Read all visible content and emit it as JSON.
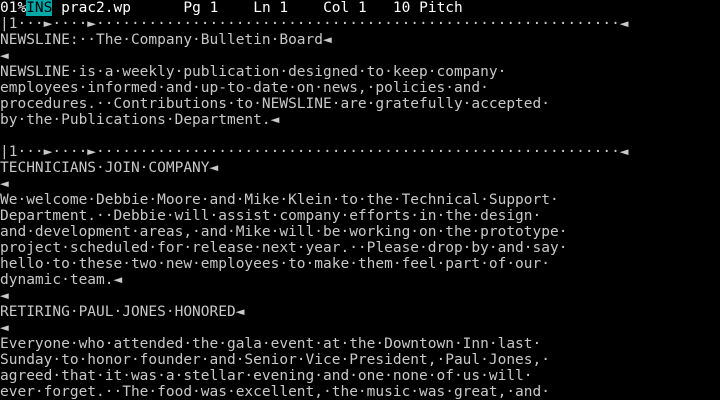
{
  "status_bar": {
    "percent": "01%",
    "mode": "INS",
    "filename": "prac2.wp",
    "page": "Pg 1",
    "line": "Ln 1",
    "column": "Col 1",
    "pitch": "10 Pitch"
  },
  "ruler": "|1···►····►····························································◄",
  "ruler2": "|1···►····►····························································◄",
  "document_lines": [
    "NEWSLINE:··The·Company·Bulletin·Board◄",
    "◄",
    "NEWSLINE·is·a·weekly·publication·designed·to·keep·company·",
    "employees·informed·and·up-to-date·on·news,·policies·and·",
    "procedures.··Contributions·to·NEWSLINE·are·gratefully·accepted·",
    "by·the·Publications·Department.◄",
    "",
    "TECHNICIANS·JOIN·COMPANY◄",
    "◄",
    "We·welcome·Debbie·Moore·and·Mike·Klein·to·the·Technical·Support·",
    "Department.··Debbie·will·assist·company·efforts·in·the·design·",
    "and·development·areas,·and·Mike·will·be·working·on·the·prototype·",
    "project·scheduled·for·release·next·year.··Please·drop·by·and·say·",
    "hello·to·these·two·new·employees·to·make·them·feel·part·of·our·",
    "dynamic·team.◄",
    "◄",
    "RETIRING·PAUL·JONES·HONORED◄",
    "◄",
    "Everyone·who·attended·the·gala·event·at·the·Downtown·Inn·last·",
    "Sunday·to·honor·founder·and·Senior·Vice·President,·Paul·Jones,·",
    "agreed·that·it·was·a·stellar·evening·and·one·none·of·us·will·",
    "ever·forget.··The·food·was·excellent,·the·music·was·great,·and·"
  ],
  "colors": {
    "background": "#000000",
    "text": "#c8c8c8",
    "ins_badge": "#00a8a8"
  }
}
